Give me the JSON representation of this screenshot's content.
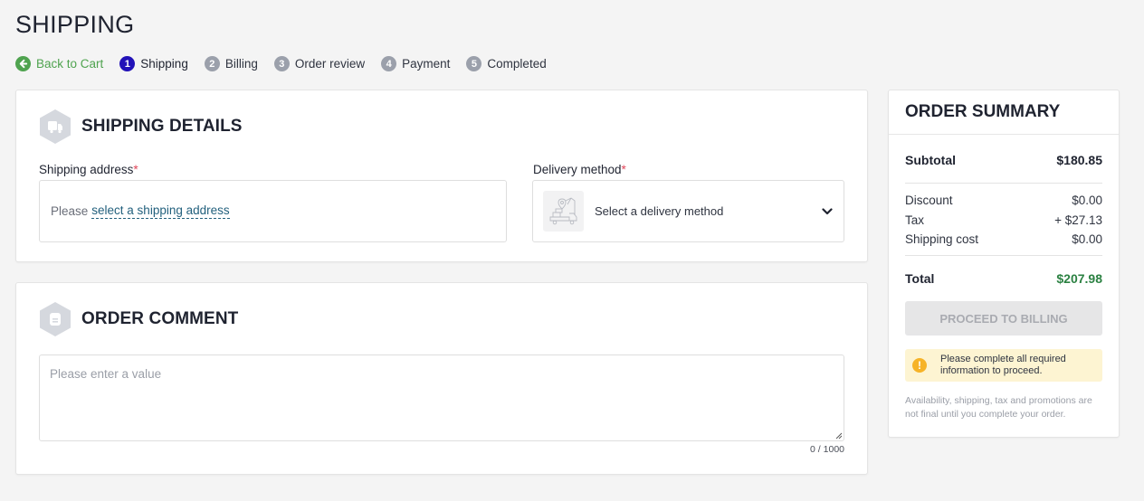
{
  "page": {
    "title": "SHIPPING"
  },
  "steps": [
    {
      "label": "Back to Cart",
      "marker": "arrow-left",
      "state": "back"
    },
    {
      "label": "Shipping",
      "marker": "1",
      "state": "active"
    },
    {
      "label": "Billing",
      "marker": "2",
      "state": "pending"
    },
    {
      "label": "Order review",
      "marker": "3",
      "state": "pending"
    },
    {
      "label": "Payment",
      "marker": "4",
      "state": "pending"
    },
    {
      "label": "Completed",
      "marker": "5",
      "state": "pending"
    }
  ],
  "shipping_details": {
    "title": "SHIPPING DETAILS",
    "icon": "truck-icon",
    "address": {
      "label": "Shipping address",
      "required_mark": "*",
      "prefix": "Please",
      "link": "select a shipping address"
    },
    "delivery": {
      "label": "Delivery method",
      "required_mark": "*",
      "placeholder": "Select a delivery method",
      "icon": "delivery-map-icon"
    }
  },
  "order_comment": {
    "title": "ORDER COMMENT",
    "icon": "document-icon",
    "placeholder": "Please enter a value",
    "value": "",
    "counter": "0 / 1000"
  },
  "summary": {
    "title": "ORDER SUMMARY",
    "subtotal": {
      "label": "Subtotal",
      "value": "$180.85"
    },
    "lines": [
      {
        "label": "Discount",
        "value": "$0.00"
      },
      {
        "label": "Tax",
        "value": "+ $27.13"
      },
      {
        "label": "Shipping cost",
        "value": "$0.00"
      }
    ],
    "total": {
      "label": "Total",
      "value": "$207.98"
    },
    "proceed_button": "PROCEED TO BILLING",
    "alert": "Please complete all required information to proceed.",
    "disclaimer": "Availability, shipping, tax and promotions are not final until you complete your order."
  },
  "colors": {
    "accent_active_step": "#2212b8",
    "back_link": "#4fa34f",
    "total": "#2b8142",
    "required": "#e0475b",
    "alert_bg": "#fdf4d2",
    "alert_icon": "#f6b327",
    "link": "#22607d"
  }
}
